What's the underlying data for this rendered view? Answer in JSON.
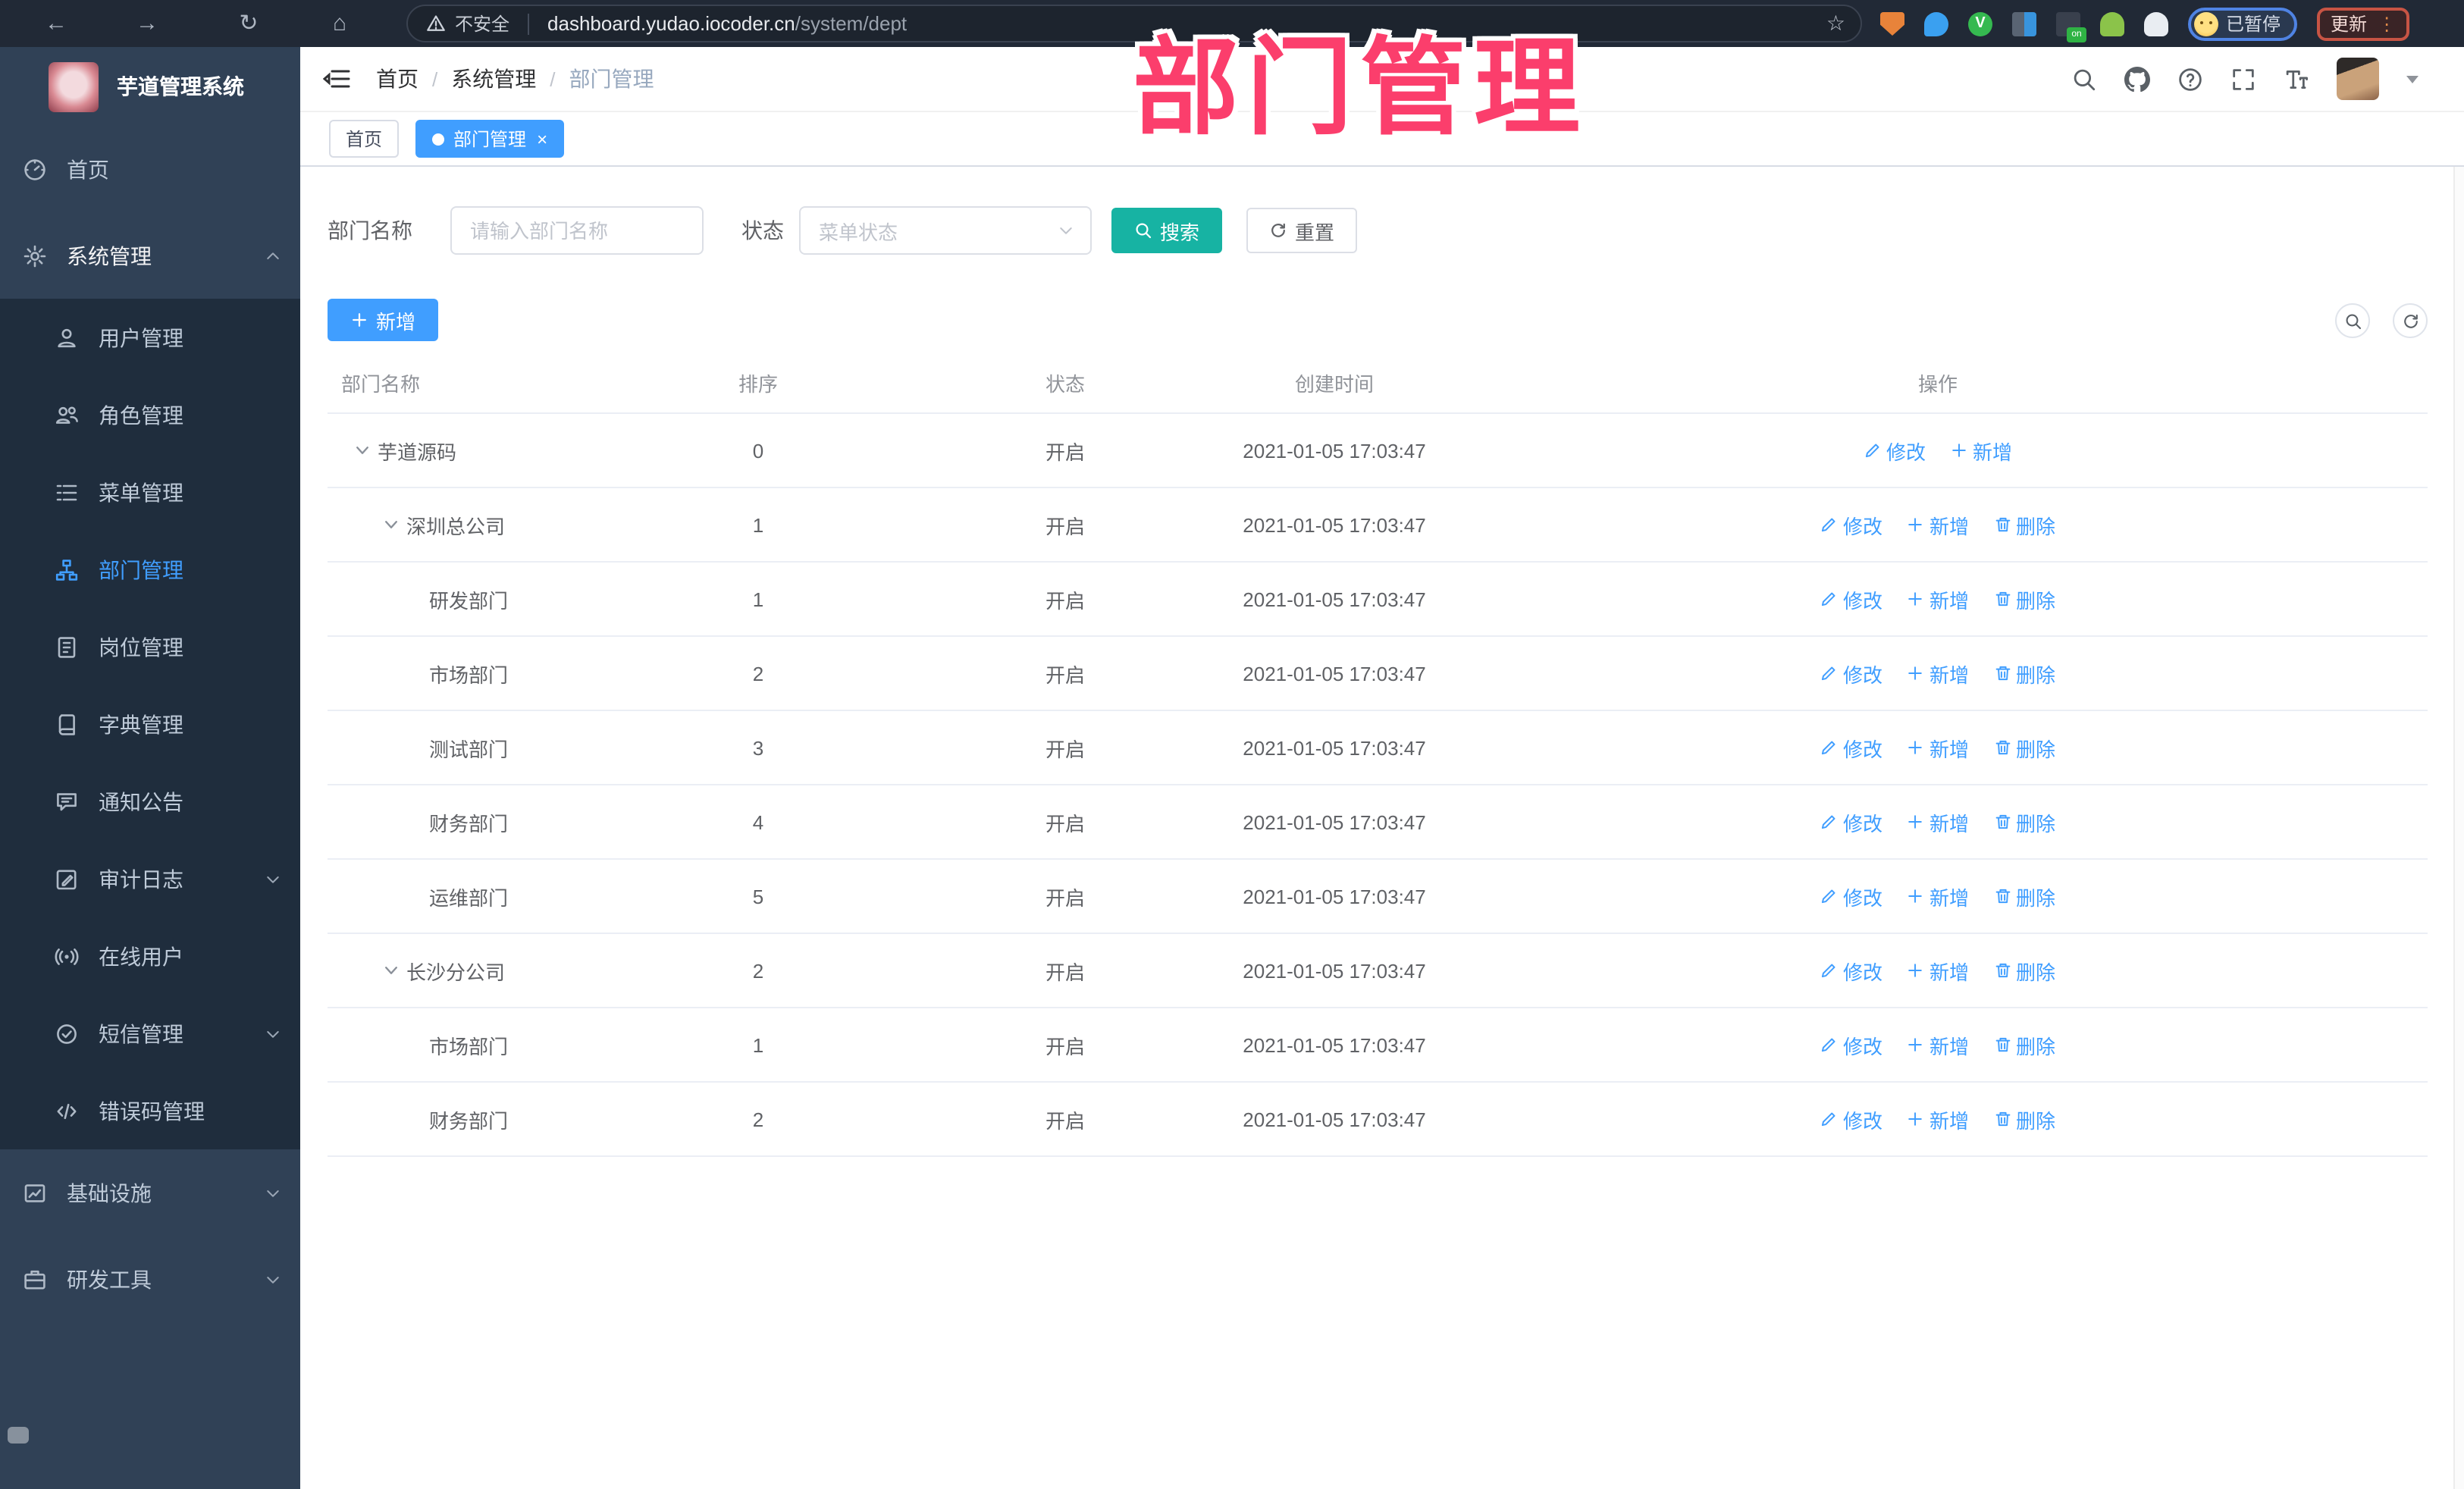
{
  "overlay_title": "部门管理",
  "browser": {
    "back": "←",
    "forward": "→",
    "reload": "↻",
    "home": "⌂",
    "star": "☆",
    "security_label": "不安全",
    "url_host": "dashboard.yudao.iocoder.cn",
    "url_path": "/system/dept",
    "switch_badge": "on",
    "check_badge": "V",
    "profile_chip": {
      "label": "已暂停"
    },
    "update_button": {
      "label": "更新",
      "dots": "⋮"
    }
  },
  "header": {
    "breadcrumb": [
      "首页",
      "系统管理",
      "部门管理"
    ]
  },
  "tabs": [
    {
      "label": "首页",
      "active": false,
      "closable": false
    },
    {
      "label": "部门管理",
      "active": true,
      "closable": true
    }
  ],
  "sidebar": {
    "app_title": "芋道管理系统",
    "items": [
      {
        "id": "home",
        "label": "首页",
        "icon": "dashboard-icon",
        "kind": "top"
      },
      {
        "id": "system",
        "label": "系统管理",
        "icon": "gear-icon",
        "kind": "top",
        "chevron": "up",
        "expanded": true
      },
      {
        "id": "user",
        "label": "用户管理",
        "icon": "user-icon",
        "kind": "sub"
      },
      {
        "id": "role",
        "label": "角色管理",
        "icon": "roles-icon",
        "kind": "sub"
      },
      {
        "id": "menu",
        "label": "菜单管理",
        "icon": "menu-tree-icon",
        "kind": "sub"
      },
      {
        "id": "dept",
        "label": "部门管理",
        "icon": "org-icon",
        "kind": "sub",
        "active": true
      },
      {
        "id": "post",
        "label": "岗位管理",
        "icon": "badge-icon",
        "kind": "sub"
      },
      {
        "id": "dict",
        "label": "字典管理",
        "icon": "dict-icon",
        "kind": "sub"
      },
      {
        "id": "notice",
        "label": "通知公告",
        "icon": "announcement-icon",
        "kind": "sub"
      },
      {
        "id": "audit",
        "label": "审计日志",
        "icon": "audit-icon",
        "kind": "sub",
        "chevron": "down"
      },
      {
        "id": "online",
        "label": "在线用户",
        "icon": "online-icon",
        "kind": "sub"
      },
      {
        "id": "sms",
        "label": "短信管理",
        "icon": "sms-icon",
        "kind": "sub",
        "chevron": "down"
      },
      {
        "id": "errcode",
        "label": "错误码管理",
        "icon": "code-icon",
        "kind": "sub"
      },
      {
        "id": "infra",
        "label": "基础设施",
        "icon": "infra-icon",
        "kind": "top",
        "chevron": "down"
      },
      {
        "id": "devtools",
        "label": "研发工具",
        "icon": "devtools-icon",
        "kind": "top",
        "chevron": "down"
      }
    ]
  },
  "search": {
    "name_label": "部门名称",
    "name_placeholder": "请输入部门名称",
    "status_label": "状态",
    "status_placeholder": "菜单状态",
    "search_label": "搜索",
    "reset_label": "重置"
  },
  "toolbar": {
    "add_label": "新增"
  },
  "table": {
    "columns": [
      "部门名称",
      "排序",
      "状态",
      "创建时间",
      "操作"
    ],
    "action_icons": {
      "修改": "edit-icon",
      "新增": "plus-icon",
      "删除": "delete-icon"
    },
    "rows": [
      {
        "name": "芋道源码",
        "level": 0,
        "caret": true,
        "sort": "0",
        "status": "开启",
        "time": "2021-01-05 17:03:47",
        "actions": [
          "修改",
          "新增"
        ]
      },
      {
        "name": "深圳总公司",
        "level": 1,
        "caret": true,
        "sort": "1",
        "status": "开启",
        "time": "2021-01-05 17:03:47",
        "actions": [
          "修改",
          "新增",
          "删除"
        ]
      },
      {
        "name": "研发部门",
        "level": 2,
        "caret": false,
        "sort": "1",
        "status": "开启",
        "time": "2021-01-05 17:03:47",
        "actions": [
          "修改",
          "新增",
          "删除"
        ]
      },
      {
        "name": "市场部门",
        "level": 2,
        "caret": false,
        "sort": "2",
        "status": "开启",
        "time": "2021-01-05 17:03:47",
        "actions": [
          "修改",
          "新增",
          "删除"
        ]
      },
      {
        "name": "测试部门",
        "level": 2,
        "caret": false,
        "sort": "3",
        "status": "开启",
        "time": "2021-01-05 17:03:47",
        "actions": [
          "修改",
          "新增",
          "删除"
        ]
      },
      {
        "name": "财务部门",
        "level": 2,
        "caret": false,
        "sort": "4",
        "status": "开启",
        "time": "2021-01-05 17:03:47",
        "actions": [
          "修改",
          "新增",
          "删除"
        ]
      },
      {
        "name": "运维部门",
        "level": 2,
        "caret": false,
        "sort": "5",
        "status": "开启",
        "time": "2021-01-05 17:03:47",
        "actions": [
          "修改",
          "新增",
          "删除"
        ]
      },
      {
        "name": "长沙分公司",
        "level": 1,
        "caret": true,
        "sort": "2",
        "status": "开启",
        "time": "2021-01-05 17:03:47",
        "actions": [
          "修改",
          "新增",
          "删除"
        ]
      },
      {
        "name": "市场部门",
        "level": 2,
        "caret": false,
        "sort": "1",
        "status": "开启",
        "time": "2021-01-05 17:03:47",
        "actions": [
          "修改",
          "新增",
          "删除"
        ]
      },
      {
        "name": "财务部门",
        "level": 2,
        "caret": false,
        "sort": "2",
        "status": "开启",
        "time": "2021-01-05 17:03:47",
        "actions": [
          "修改",
          "新增",
          "删除"
        ]
      }
    ]
  },
  "colors": {
    "accent": "#409eff",
    "search_button": "#17b3a3",
    "overlay_pink": "#fb3e6c",
    "sidebar_bg": "#304156",
    "submenu_bg": "#1f2d3d"
  }
}
